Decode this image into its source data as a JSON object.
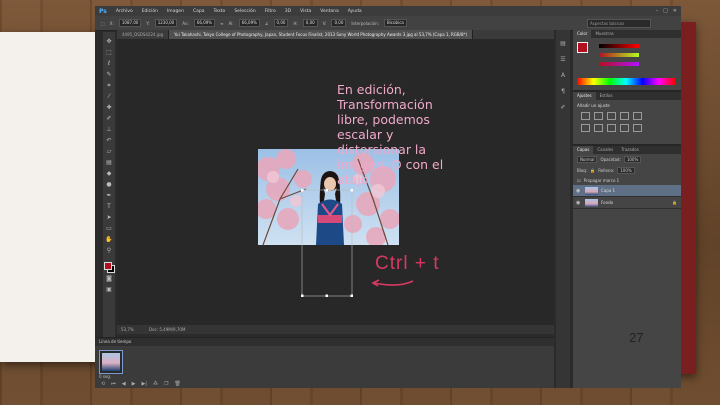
{
  "app": {
    "logo": "Ps",
    "menu": [
      "Archivo",
      "Edición",
      "Imagen",
      "Capa",
      "Texto",
      "Selección",
      "Filtro",
      "3D",
      "Vista",
      "Ventana",
      "Ayuda"
    ]
  },
  "options_bar": {
    "x_value": "1087,00",
    "y_value": "1230,00",
    "w_value": "66,09%",
    "h_value": "66,09%",
    "angle_value": "0,00",
    "hskew_value": "0,00",
    "vskew_value": "0,00",
    "interpolation_label": "Interpolación:",
    "interpolation_value": "Bicúbica",
    "search_placeholder": "Aspectos básicos"
  },
  "document": {
    "tabs": [
      "4495_DSDS4224.jpg",
      "Yui Takahashi, Tokyo College of Photography, Japan, Student Focus Finalist, 2013 Sony World Photography Awards 3.jpg al 53,7% (Capa 1, RGB/8*)"
    ],
    "status_zoom": "53,7%",
    "status_doc": "Doc: 5,49M/9,70M"
  },
  "annotation": {
    "note": "En edición, Transformación libre, podemos escalar y distorsionar la imagen. O con el atajo.",
    "shortcut": "Ctrl + t",
    "page_number": "27"
  },
  "panels": {
    "color_tabs": [
      "Color",
      "Muestras"
    ],
    "adjust_tabs": [
      "Ajustes",
      "Estilos"
    ],
    "adjust_title": "Añadir un ajuste",
    "layers_tabs": [
      "Capas",
      "Canales",
      "Trazados"
    ],
    "blend_mode": "Normal",
    "opacity_label": "Opacidad:",
    "opacity_value": "100%",
    "lock_label": "Bloq:",
    "fill_label": "Relleno:",
    "fill_value": "100%",
    "propagate_label": "Propagar marco 1",
    "layers": [
      {
        "name": "Capa 1",
        "selected": true
      },
      {
        "name": "Fondo",
        "selected": false
      }
    ]
  },
  "timeline": {
    "title": "Línea de tiempo",
    "frame_label": "0 seg."
  }
}
